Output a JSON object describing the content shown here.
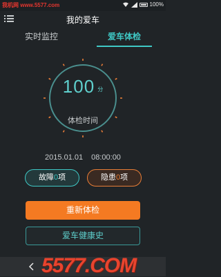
{
  "status_bar": {
    "watermark": "我机网 www.5577.com",
    "battery_text": "100%"
  },
  "header": {
    "title": "我的爱车"
  },
  "tabs": [
    {
      "label": "实时监控",
      "active": false
    },
    {
      "label": "爱车体检",
      "active": true
    }
  ],
  "score": {
    "value": "100",
    "unit": "分",
    "label": "体检时间"
  },
  "check_time": {
    "date": "2015.01.01",
    "time": "08:00:00"
  },
  "fault": {
    "label": "故障",
    "count": "0",
    "suffix": "项"
  },
  "danger": {
    "label": "隐患",
    "count": "0",
    "suffix": "项"
  },
  "buttons": {
    "recheck": "重新体检",
    "history": "爱车健康史"
  },
  "brand_mark": "5577.COM",
  "colors": {
    "accent": "#3fc9c6",
    "warning": "#f47a22",
    "background": "#202427"
  },
  "icons": [
    "wifi-icon",
    "signal-icon",
    "battery-icon",
    "menu-icon",
    "back-icon"
  ]
}
